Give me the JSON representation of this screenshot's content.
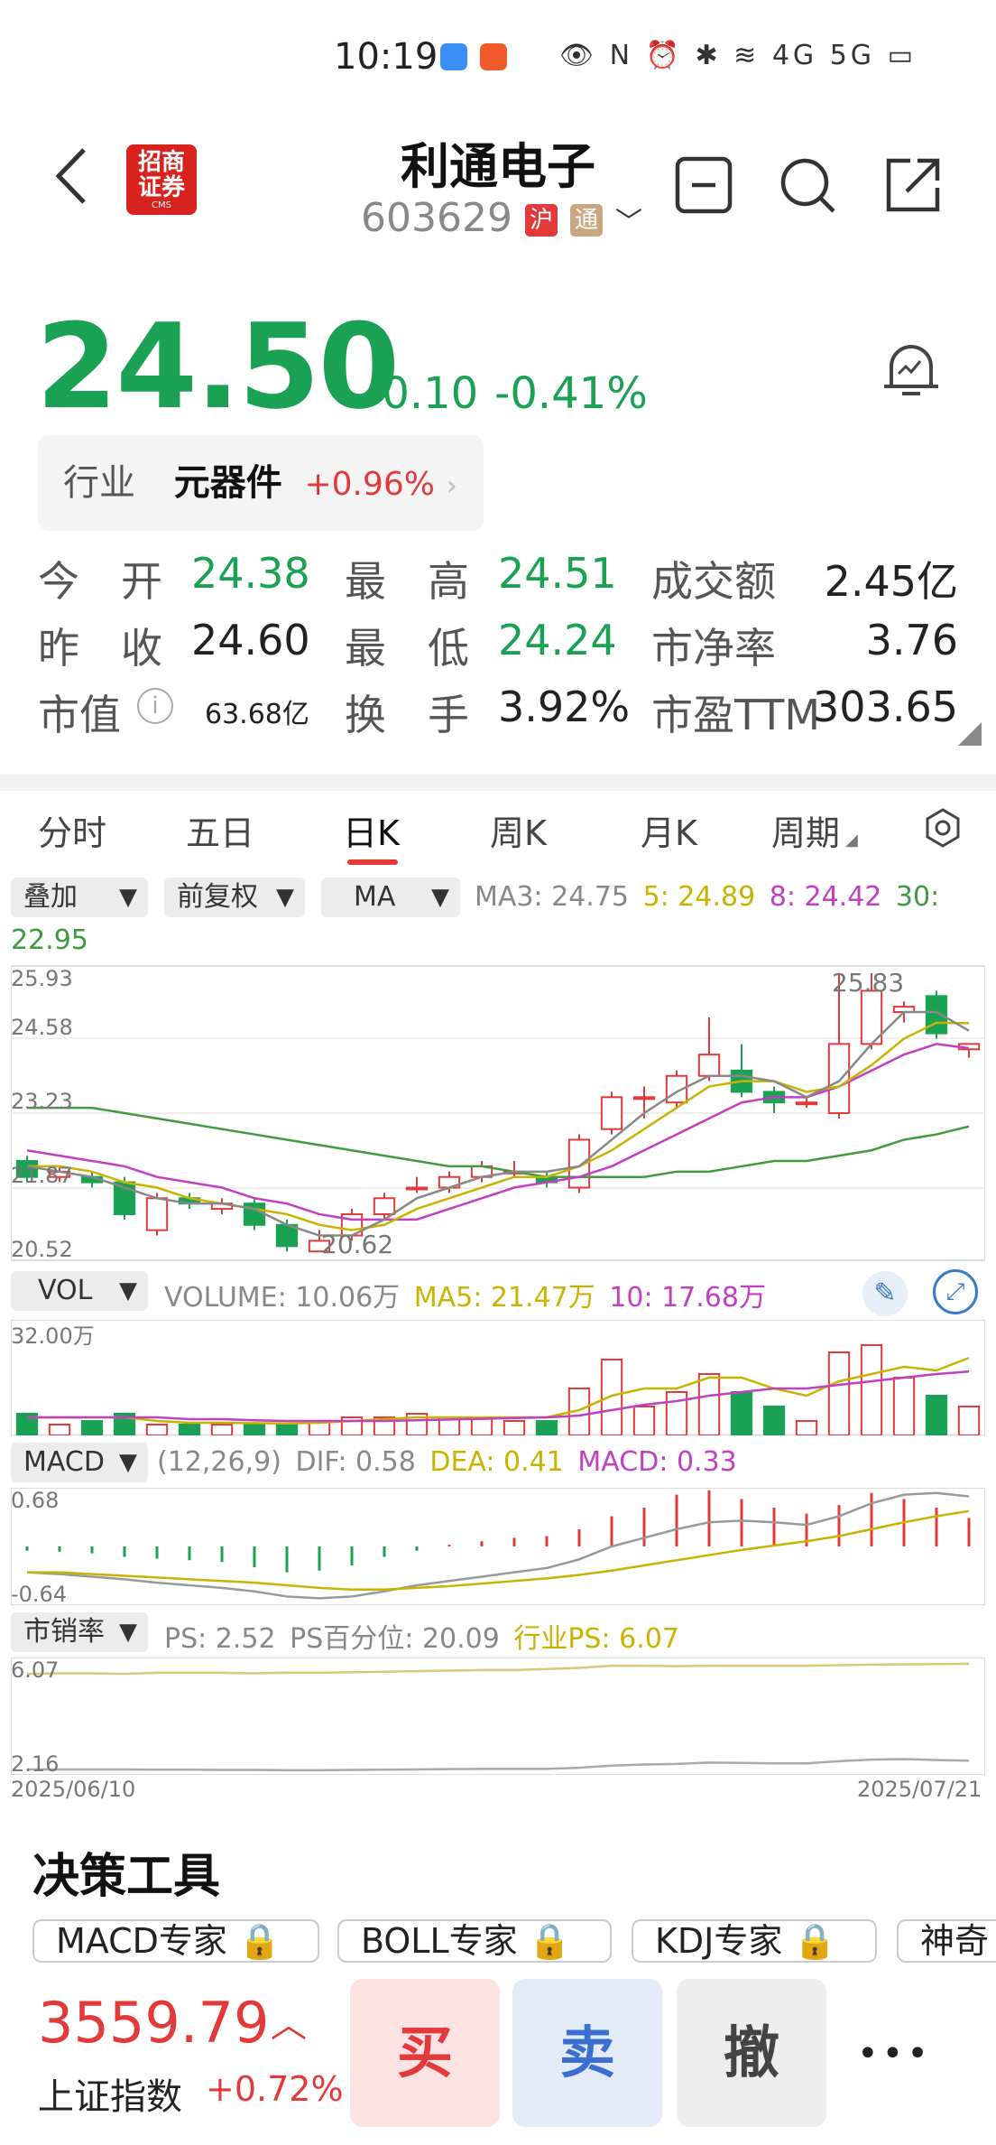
{
  "status_bar": {
    "time": "10:19",
    "icons": "👁 N ⏰ ✱ ≋ 4G 5G ▭"
  },
  "header": {
    "title": "利通电子",
    "code": "603629",
    "market_tag": "沪",
    "connect_tag": "通",
    "broker_logo_line1": "招商",
    "broker_logo_line2": "证券",
    "broker_logo_sub": "CMS"
  },
  "quote": {
    "price": "24.50",
    "change": "-0.10",
    "change_pct": "-0.41%"
  },
  "industry": {
    "label": "行业",
    "name": "元器件",
    "change": "+0.96%"
  },
  "stats": {
    "open_label": "今　开",
    "open": "24.38",
    "high_label": "最　高",
    "high": "24.51",
    "turnover_amt_label": "成交额",
    "turnover_amt": "2.45亿",
    "prev_label": "昨　收",
    "prev": "24.60",
    "low_label": "最　低",
    "low": "24.24",
    "pb_label": "市净率",
    "pb": "3.76",
    "mcap_label": "市值",
    "mcap": "63.68亿",
    "turn_label": "换　手",
    "turn": "3.92%",
    "pe_label": "市盈TTM",
    "pe": "303.65"
  },
  "tabs": [
    "分时",
    "五日",
    "日K",
    "周K",
    "月K",
    "周期"
  ],
  "controls": {
    "overlay": "叠加",
    "adjust": "前复权",
    "ma": "MA"
  },
  "ma_legend": {
    "ma3": "MA3: 24.75",
    "ma5": "5: 24.89",
    "ma8": "8: 24.42",
    "ma30": "30:",
    "ma30_val": "22.95"
  },
  "kline": {
    "y_labels": [
      "25.93",
      "24.58",
      "23.23",
      "21.87",
      "20.52"
    ],
    "max_label": "25.83",
    "min_label": "20.62"
  },
  "volume": {
    "select": "VOL",
    "vol": "VOLUME: 10.06万",
    "ma5": "MA5: 21.47万",
    "ma10": "10: 17.68万",
    "y_top": "32.00万"
  },
  "macd": {
    "select": "MACD",
    "params": "(12,26,9)",
    "dif": "DIF: 0.58",
    "dea": "DEA: 0.41",
    "macd": "MACD: 0.33",
    "y_top": "0.68",
    "y_bottom": "-0.64"
  },
  "ps": {
    "select": "市销率",
    "ps": "PS: 2.52",
    "pct": "PS百分位: 20.09",
    "ind": "行业PS: 6.07",
    "y_top": "6.07",
    "y_bottom": "2.16",
    "date_start": "2025/06/10",
    "date_end": "2025/07/21"
  },
  "tools": {
    "title": "决策工具",
    "chips": [
      "MACD专家 🔒",
      "BOLL专家 🔒",
      "KDJ专家 🔒",
      "神奇"
    ]
  },
  "index": {
    "value": "3559.79",
    "name": "上证指数",
    "change": "+0.72%"
  },
  "actions": {
    "buy": "买",
    "sell": "卖",
    "cancel": "撤",
    "more": "•••"
  },
  "colors": {
    "up": "#e23a3a",
    "down": "#1aa153",
    "ma3": "#888888",
    "ma5": "#c8b400",
    "ma8": "#c23fc2",
    "ma30": "#3f9b3f"
  },
  "chart_data": {
    "type": "candlestick",
    "candles": [
      {
        "o": 22.3,
        "c": 22.0,
        "h": 22.4,
        "l": 21.9
      },
      {
        "o": 22.0,
        "c": 22.1,
        "h": 22.2,
        "l": 21.9
      },
      {
        "o": 22.0,
        "c": 21.9,
        "h": 22.1,
        "l": 21.8
      },
      {
        "o": 21.9,
        "c": 21.3,
        "h": 22.0,
        "l": 21.2
      },
      {
        "o": 21.0,
        "c": 21.6,
        "h": 21.7,
        "l": 20.9
      },
      {
        "o": 21.6,
        "c": 21.5,
        "h": 21.7,
        "l": 21.4
      },
      {
        "o": 21.4,
        "c": 21.5,
        "h": 21.6,
        "l": 21.3
      },
      {
        "o": 21.5,
        "c": 21.1,
        "h": 21.6,
        "l": 21.0
      },
      {
        "o": 21.1,
        "c": 20.7,
        "h": 21.2,
        "l": 20.6
      },
      {
        "o": 20.6,
        "c": 20.8,
        "h": 21.0,
        "l": 20.62
      },
      {
        "o": 20.9,
        "c": 21.3,
        "h": 21.4,
        "l": 20.8
      },
      {
        "o": 21.3,
        "c": 21.6,
        "h": 21.7,
        "l": 21.2
      },
      {
        "o": 21.8,
        "c": 21.8,
        "h": 22.0,
        "l": 21.7
      },
      {
        "o": 21.8,
        "c": 22.0,
        "h": 22.1,
        "l": 21.7
      },
      {
        "o": 22.0,
        "c": 22.2,
        "h": 22.3,
        "l": 21.9
      },
      {
        "o": 22.1,
        "c": 22.1,
        "h": 22.3,
        "l": 22.0
      },
      {
        "o": 22.0,
        "c": 21.9,
        "h": 22.1,
        "l": 21.8
      },
      {
        "o": 21.8,
        "c": 22.7,
        "h": 22.8,
        "l": 21.7
      },
      {
        "o": 22.9,
        "c": 23.5,
        "h": 23.6,
        "l": 22.8
      },
      {
        "o": 23.5,
        "c": 23.5,
        "h": 23.7,
        "l": 23.1
      },
      {
        "o": 23.4,
        "c": 23.9,
        "h": 24.0,
        "l": 23.3
      },
      {
        "o": 23.9,
        "c": 24.3,
        "h": 25.0,
        "l": 23.8
      },
      {
        "o": 24.0,
        "c": 23.6,
        "h": 24.5,
        "l": 23.5
      },
      {
        "o": 23.6,
        "c": 23.4,
        "h": 23.7,
        "l": 23.2
      },
      {
        "o": 23.4,
        "c": 23.4,
        "h": 23.5,
        "l": 23.3
      },
      {
        "o": 23.2,
        "c": 24.5,
        "h": 25.83,
        "l": 23.1
      },
      {
        "o": 24.5,
        "c": 25.5,
        "h": 25.83,
        "l": 24.4
      },
      {
        "o": 25.1,
        "c": 25.2,
        "h": 25.3,
        "l": 24.9
      },
      {
        "o": 25.4,
        "c": 24.7,
        "h": 25.5,
        "l": 24.6
      },
      {
        "o": 24.4,
        "c": 24.5,
        "h": 24.51,
        "l": 24.24
      }
    ],
    "ma3": [
      22.2,
      22.1,
      22.0,
      21.8,
      21.6,
      21.5,
      21.5,
      21.4,
      21.1,
      20.9,
      20.9,
      21.2,
      21.6,
      21.8,
      22.0,
      22.1,
      22.1,
      22.2,
      22.7,
      23.2,
      23.6,
      23.9,
      23.9,
      23.8,
      23.5,
      23.8,
      24.5,
      25.1,
      25.1,
      24.75
    ],
    "ma5": [
      22.2,
      22.2,
      22.1,
      21.9,
      21.8,
      21.6,
      21.5,
      21.4,
      21.3,
      21.1,
      21.0,
      21.1,
      21.4,
      21.6,
      21.8,
      22.0,
      22.0,
      22.2,
      22.5,
      22.9,
      23.3,
      23.7,
      23.8,
      23.8,
      23.6,
      23.7,
      24.1,
      24.6,
      24.9,
      24.89
    ],
    "ma8": [
      22.5,
      22.4,
      22.3,
      22.2,
      22.0,
      21.9,
      21.8,
      21.6,
      21.5,
      21.3,
      21.2,
      21.2,
      21.2,
      21.4,
      21.6,
      21.8,
      21.9,
      22.0,
      22.2,
      22.5,
      22.8,
      23.1,
      23.4,
      23.5,
      23.5,
      23.7,
      24.0,
      24.3,
      24.5,
      24.42
    ],
    "ma30": [
      23.3,
      23.3,
      23.3,
      23.2,
      23.1,
      23.0,
      22.9,
      22.8,
      22.7,
      22.6,
      22.5,
      22.4,
      22.3,
      22.2,
      22.2,
      22.1,
      22.0,
      22.0,
      22.0,
      22.0,
      22.1,
      22.1,
      22.2,
      22.3,
      22.3,
      22.4,
      22.5,
      22.7,
      22.8,
      22.95
    ],
    "volume": [
      6,
      3,
      4,
      6,
      3,
      3,
      3,
      3,
      3,
      4,
      5,
      5,
      6,
      5,
      5,
      4,
      4,
      13,
      21,
      8,
      12,
      17,
      12,
      8,
      4,
      23,
      25,
      16,
      11,
      8
    ],
    "vol_ma5": [
      5,
      5,
      5,
      5,
      4,
      3.5,
      3.5,
      3.4,
      3.3,
      3.5,
      4,
      4.5,
      5,
      5,
      5,
      5,
      5,
      7,
      11,
      13,
      13,
      16,
      16,
      13,
      11,
      15,
      17,
      19,
      18,
      21.47
    ],
    "vol_ma10": [
      5,
      5,
      5,
      5,
      5,
      4.5,
      4.5,
      4.2,
      4,
      4,
      4,
      4,
      4.2,
      4.4,
      4.6,
      4.8,
      5,
      5.5,
      7,
      8.5,
      9.5,
      11,
      12,
      13,
      13,
      14,
      15,
      16,
      17,
      17.68
    ],
    "macd_bar": [
      -0.05,
      -0.06,
      -0.08,
      -0.12,
      -0.14,
      -0.16,
      -0.18,
      -0.24,
      -0.3,
      -0.28,
      -0.22,
      -0.12,
      -0.05,
      0.02,
      0.06,
      0.1,
      0.12,
      0.2,
      0.35,
      0.45,
      0.6,
      0.65,
      0.55,
      0.45,
      0.38,
      0.48,
      0.62,
      0.55,
      0.45,
      0.33
    ],
    "dif": [
      -0.3,
      -0.32,
      -0.35,
      -0.38,
      -0.42,
      -0.45,
      -0.48,
      -0.52,
      -0.58,
      -0.6,
      -0.58,
      -0.52,
      -0.45,
      -0.4,
      -0.35,
      -0.3,
      -0.25,
      -0.15,
      0.0,
      0.1,
      0.2,
      0.28,
      0.3,
      0.28,
      0.25,
      0.35,
      0.5,
      0.6,
      0.62,
      0.58
    ],
    "dea": [
      -0.3,
      -0.3,
      -0.32,
      -0.34,
      -0.36,
      -0.38,
      -0.4,
      -0.42,
      -0.45,
      -0.48,
      -0.5,
      -0.5,
      -0.48,
      -0.46,
      -0.43,
      -0.4,
      -0.37,
      -0.33,
      -0.28,
      -0.22,
      -0.16,
      -0.1,
      -0.04,
      0.01,
      0.06,
      0.12,
      0.2,
      0.28,
      0.35,
      0.41
    ],
    "ps": [
      2.2,
      2.2,
      2.2,
      2.2,
      2.19,
      2.19,
      2.18,
      2.18,
      2.17,
      2.17,
      2.18,
      2.19,
      2.2,
      2.21,
      2.22,
      2.22,
      2.22,
      2.26,
      2.34,
      2.38,
      2.4,
      2.45,
      2.44,
      2.42,
      2.42,
      2.5,
      2.56,
      2.58,
      2.54,
      2.52
    ],
    "ps_ind": [
      5.7,
      5.72,
      5.72,
      5.7,
      5.74,
      5.74,
      5.74,
      5.72,
      5.74,
      5.74,
      5.76,
      5.78,
      5.8,
      5.82,
      5.84,
      5.84,
      5.88,
      5.92,
      6.0,
      6.0,
      5.98,
      6.0,
      6.0,
      6.0,
      6.0,
      6.02,
      6.04,
      6.05,
      6.06,
      6.07
    ]
  }
}
